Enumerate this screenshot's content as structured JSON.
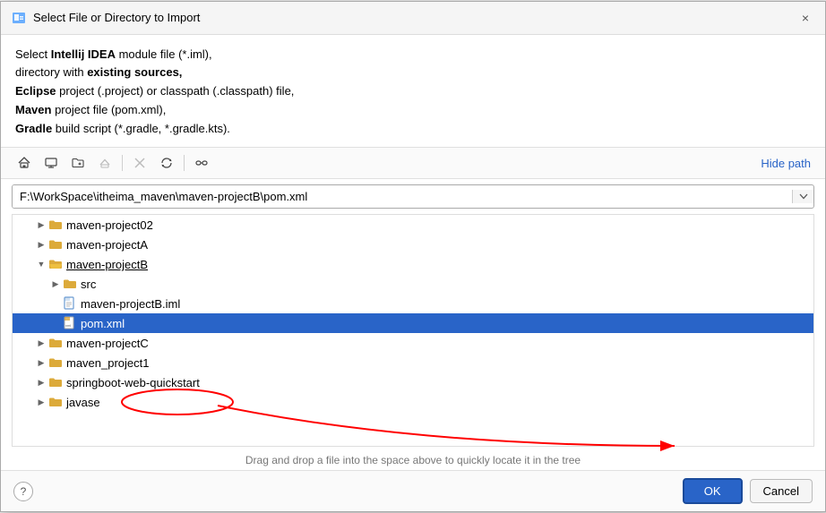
{
  "dialog": {
    "title": "Select File or Directory to Import",
    "close_label": "×"
  },
  "description": {
    "line1": "Select Intellij IDEA module file (*.iml),",
    "line2": "directory with existing sources,",
    "line3": "Eclipse project (.project) or classpath (.classpath) file,",
    "line4": "Maven project file (pom.xml),",
    "line5": "Gradle build script (*.gradle, *.gradle.kts)."
  },
  "toolbar": {
    "hide_path_label": "Hide path"
  },
  "path_bar": {
    "value": "F:\\WorkSpace\\itheima_maven\\maven-projectB\\pom.xml"
  },
  "tree": {
    "items": [
      {
        "id": "maven-project02",
        "label": "maven-project02",
        "type": "folder",
        "indent": 1,
        "expandable": true,
        "expanded": false,
        "selected": false
      },
      {
        "id": "maven-projectA",
        "label": "maven-projectA",
        "type": "folder",
        "indent": 1,
        "expandable": true,
        "expanded": false,
        "selected": false
      },
      {
        "id": "maven-projectB",
        "label": "maven-projectB",
        "type": "folder",
        "indent": 1,
        "expandable": true,
        "expanded": true,
        "selected": false,
        "underline": true
      },
      {
        "id": "src",
        "label": "src",
        "type": "folder",
        "indent": 2,
        "expandable": true,
        "expanded": false,
        "selected": false
      },
      {
        "id": "maven-projectB.iml",
        "label": "maven-projectB.iml",
        "type": "file-iml",
        "indent": 2,
        "expandable": false,
        "expanded": false,
        "selected": false
      },
      {
        "id": "pom.xml",
        "label": "pom.xml",
        "type": "file-xml",
        "indent": 2,
        "expandable": false,
        "expanded": false,
        "selected": true
      },
      {
        "id": "maven-projectC",
        "label": "maven-projectC",
        "type": "folder",
        "indent": 1,
        "expandable": true,
        "expanded": false,
        "selected": false
      },
      {
        "id": "maven_project1",
        "label": "maven_project1",
        "type": "folder",
        "indent": 1,
        "expandable": true,
        "expanded": false,
        "selected": false
      },
      {
        "id": "springboot-web-quickstart",
        "label": "springboot-web-quickstart",
        "type": "folder",
        "indent": 1,
        "expandable": true,
        "expanded": false,
        "selected": false
      },
      {
        "id": "javase",
        "label": "javase",
        "type": "folder",
        "indent": 1,
        "expandable": true,
        "expanded": false,
        "selected": false
      }
    ]
  },
  "drag_hint": "Drag and drop a file into the space above to quickly locate it in the tree",
  "buttons": {
    "ok_label": "OK",
    "cancel_label": "Cancel",
    "help_label": "?"
  }
}
